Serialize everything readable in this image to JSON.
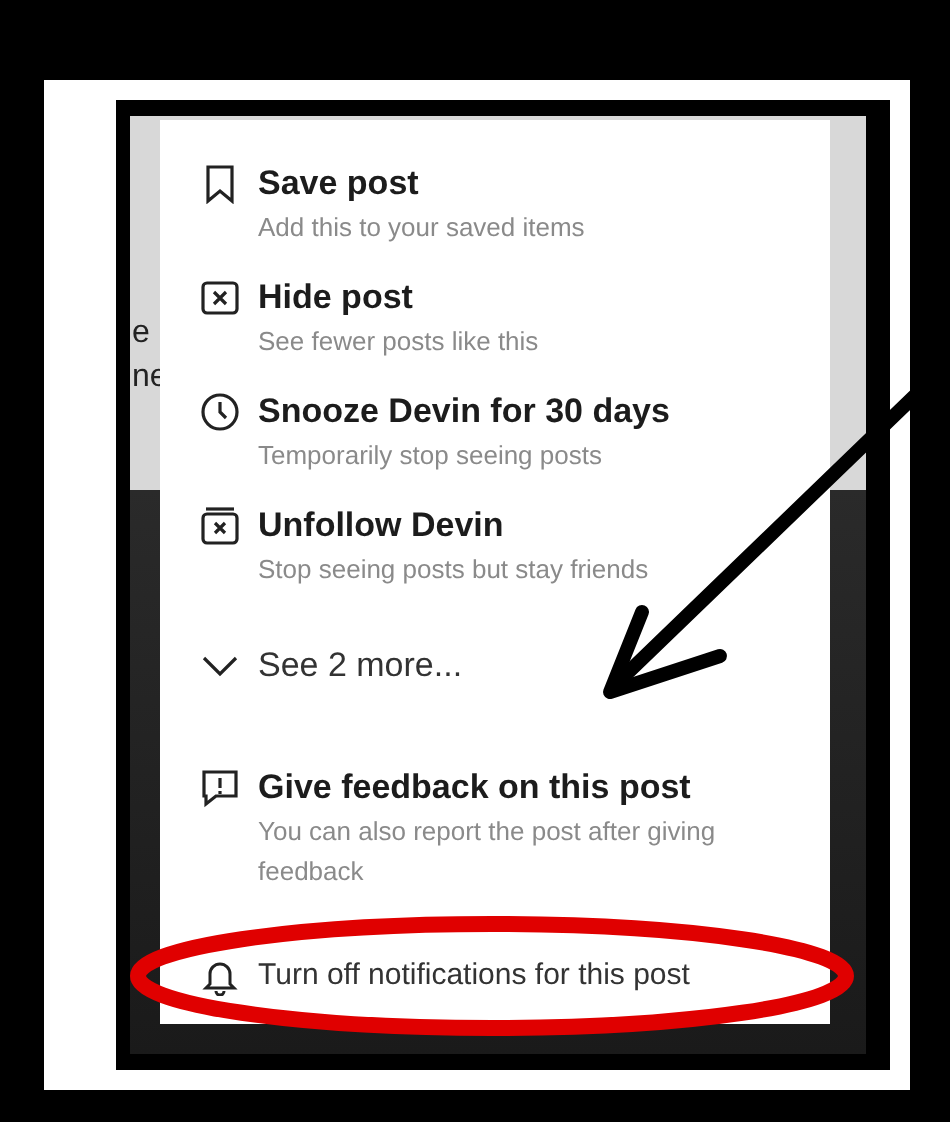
{
  "background_text": [
    "e",
    "ne"
  ],
  "menu": {
    "items": [
      {
        "kind": "option",
        "title": "Save post",
        "subtitle": "Add this to your saved items"
      },
      {
        "kind": "option",
        "title": "Hide post",
        "subtitle": "See fewer posts like this"
      },
      {
        "kind": "option",
        "title": "Snooze Devin for 30 days",
        "subtitle": "Temporarily stop seeing posts"
      },
      {
        "kind": "option",
        "title": "Unfollow Devin",
        "subtitle": "Stop seeing posts but stay friends"
      },
      {
        "kind": "more",
        "title": "See 2 more..."
      },
      {
        "kind": "option",
        "title": "Give feedback on this post",
        "subtitle": "You can also report the post after giving feedback"
      },
      {
        "kind": "plain",
        "title": "Turn off notifications for this post"
      }
    ]
  }
}
